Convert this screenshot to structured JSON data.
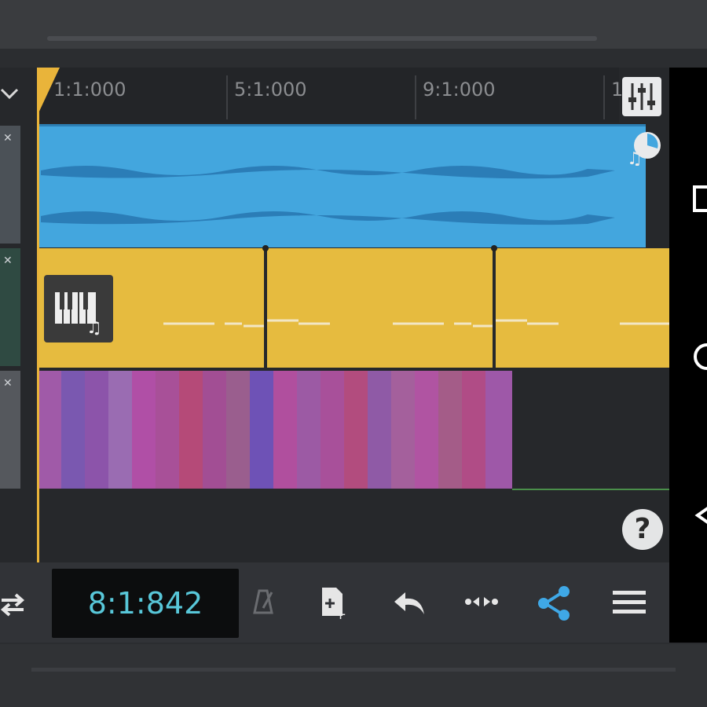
{
  "ruler": {
    "labels": [
      "1:1:000",
      "5:1:000",
      "9:1:000",
      "1"
    ]
  },
  "toolbar": {
    "time_display": "8:1:842"
  },
  "help": {
    "label": "?"
  },
  "icons": {
    "collapse": "chevron-down-icon",
    "mixer": "mixer-sliders-icon",
    "audio_clip": "audio-note-icon",
    "instrument": "piano-keyboard-icon",
    "loop": "loop-icon",
    "metronome": "metronome-icon",
    "add_track": "add-file-icon",
    "undo": "undo-icon",
    "snap": "snap-icon",
    "share": "share-icon",
    "menu": "menu-icon",
    "help": "help-icon",
    "nav_recent": "recents-icon",
    "nav_home": "home-icon",
    "nav_back": "back-icon"
  },
  "colors": {
    "audio_clip": "#43a6de",
    "midi_clip": "#e6bb3f",
    "playhead": "#e9b43a",
    "time_display_text": "#58c7d9",
    "share_accent": "#3fa8e6"
  }
}
